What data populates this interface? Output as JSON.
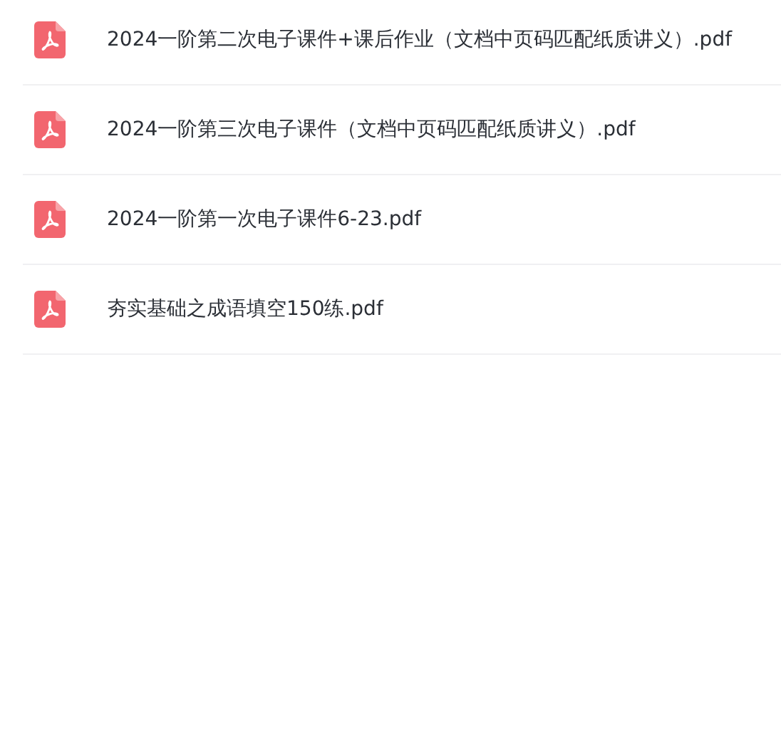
{
  "files": [
    {
      "name": "2024一阶第二次电子课件+课后作业（文档中页码匹配纸质讲义）.pdf"
    },
    {
      "name": "2024一阶第三次电子课件（文档中页码匹配纸质讲义）.pdf"
    },
    {
      "name": "2024一阶第一次电子课件6-23.pdf"
    },
    {
      "name": "夯实基础之成语填空150练.pdf"
    }
  ]
}
